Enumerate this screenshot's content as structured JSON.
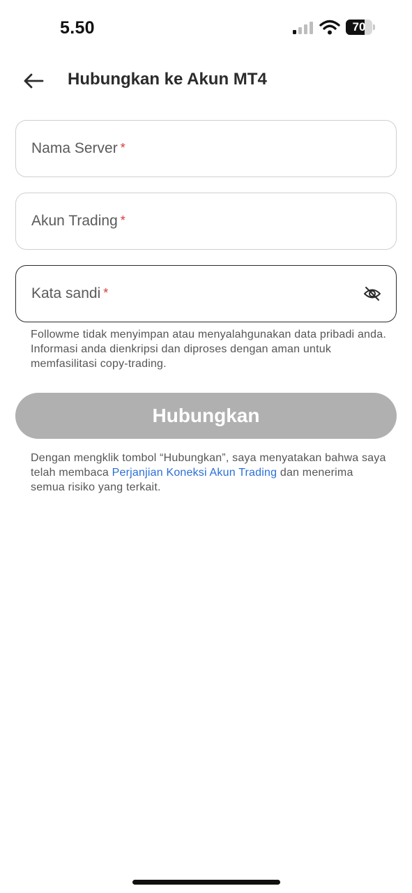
{
  "status_bar": {
    "time": "5.50",
    "battery_level": "70",
    "battery_fraction": 0.7
  },
  "header": {
    "back_icon": "arrow-left-icon",
    "title": "Hubungkan ke Akun MT4"
  },
  "form": {
    "server_field": {
      "label": "Nama Server",
      "required_mark": "*",
      "value": ""
    },
    "account_field": {
      "label": "Akun Trading",
      "required_mark": "*",
      "value": ""
    },
    "password_field": {
      "label": "Kata sandi",
      "required_mark": "*",
      "value": "",
      "toggle_icon": "eye-off-icon"
    },
    "privacy_note": "Followme tidak menyimpan atau menyalahgunakan data pribadi anda. Informasi anda dienkripsi dan diproses dengan aman untuk memfasilitasi copy-trading."
  },
  "connect_button": {
    "label": "Hubungkan",
    "color": "#b0b0b0"
  },
  "consent": {
    "prefix": "Dengan mengklik tombol “Hubungkan”, saya menyatakan bahwa saya telah membaca ",
    "link_text": "Perjanjian Koneksi Akun Trading",
    "suffix": " dan menerima semua risiko yang terkait.",
    "link_color": "#2a6fd6"
  },
  "colors": {
    "required": "#d63b3b",
    "focused_border": "#2a2a2a",
    "field_border": "#cfcfcf"
  }
}
